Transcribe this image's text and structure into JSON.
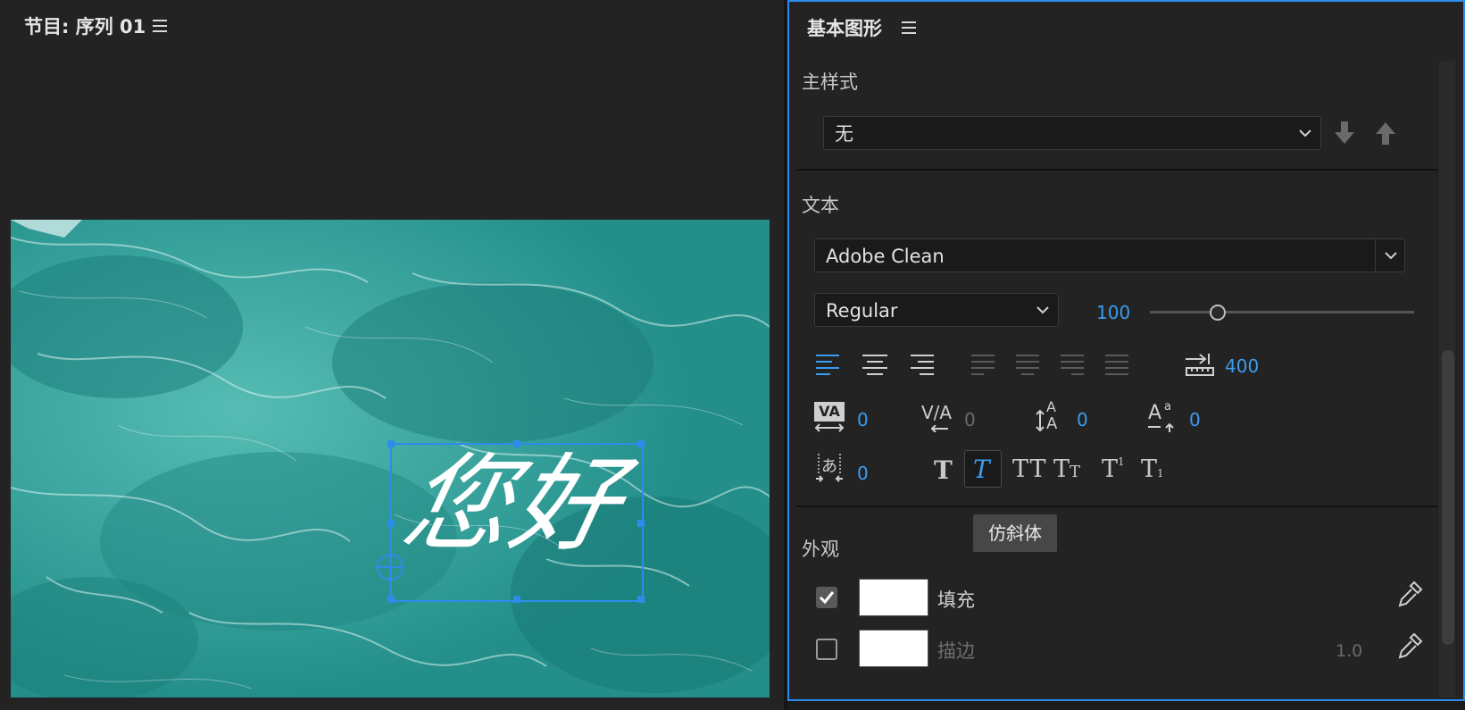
{
  "program_monitor": {
    "title": "节目: 序列 01",
    "title_text": "您好"
  },
  "essential_graphics": {
    "title": "基本图形",
    "master_style": {
      "label": "主样式",
      "value": "无"
    },
    "text_section": {
      "label": "文本",
      "font": "Adobe Clean",
      "style": "Regular",
      "font_size": "100",
      "font_size_level": 0.25,
      "tab_width": "400",
      "tracking": "0",
      "kerning": "0",
      "leading": "0",
      "baseline_shift": "0",
      "tsume": "0"
    },
    "tooltip": "仿斜体",
    "appearance": {
      "label": "外观",
      "fill_label": "填充",
      "fill_checked": true,
      "stroke_label": "描边",
      "stroke_checked": false,
      "stroke_width": "1.0"
    },
    "colors": {
      "accent": "#2d8ceb",
      "value_blue": "#3b9cf0"
    }
  }
}
